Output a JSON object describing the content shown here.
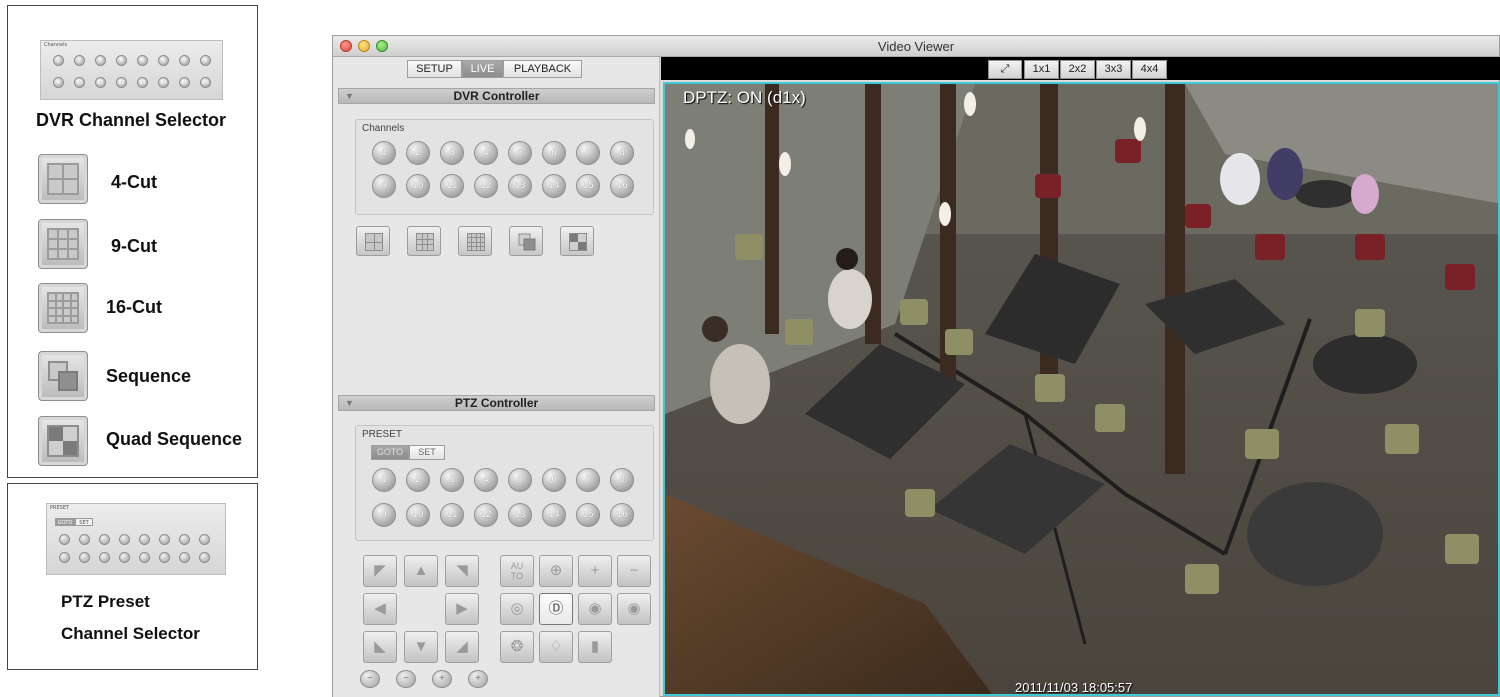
{
  "legend": {
    "channel_selector": {
      "caption": "Channels",
      "buttons": [
        "1",
        "2",
        "3",
        "4",
        "5",
        "6",
        "7",
        "8",
        "9",
        "10",
        "11",
        "12",
        "13",
        "14",
        "15",
        "16"
      ],
      "title": "DVR Channel Selector"
    },
    "items": [
      {
        "label": "4-Cut",
        "icon": "grid-2x2-icon"
      },
      {
        "label": "9-Cut",
        "icon": "grid-3x3-icon"
      },
      {
        "label": "16-Cut",
        "icon": "grid-4x4-icon"
      },
      {
        "label": "Sequence",
        "icon": "sequence-icon"
      },
      {
        "label": "Quad Sequence",
        "icon": "quad-sequence-icon"
      }
    ],
    "preset": {
      "caption": "PRESET",
      "goto_label": "GOTO",
      "set_label": "SET",
      "title_line1": "PTZ Preset",
      "title_line2": "Channel Selector"
    }
  },
  "window": {
    "title": "Video Viewer",
    "mode_tabs": [
      {
        "label": "SETUP",
        "active": false
      },
      {
        "label": "LIVE",
        "active": true
      },
      {
        "label": "PLAYBACK",
        "active": false
      }
    ],
    "dvr_controller": {
      "header": "DVR Controller",
      "channels_caption": "Channels",
      "channels": [
        "1",
        "2",
        "3",
        "4",
        "5",
        "6",
        "7",
        "8",
        "9",
        "10",
        "11",
        "12",
        "13",
        "14",
        "15",
        "16"
      ],
      "view_tools": [
        "grid-2x2-icon",
        "grid-3x3-icon",
        "grid-4x4-icon",
        "sequence-icon",
        "quad-sequence-icon"
      ]
    },
    "ptz_controller": {
      "header": "PTZ Controller",
      "preset_caption": "PRESET",
      "goto_label": "GOTO",
      "set_label": "SET",
      "presets": [
        "1",
        "2",
        "3",
        "4",
        "5",
        "6",
        "7",
        "8",
        "9",
        "10",
        "11",
        "12",
        "13",
        "14",
        "15",
        "16"
      ],
      "direction_icons": [
        "arrow-up-left-icon",
        "arrow-up-icon",
        "arrow-up-right-icon",
        "arrow-left-icon",
        "arrow-right-icon",
        "arrow-down-left-icon",
        "arrow-down-icon",
        "arrow-down-right-icon"
      ],
      "function_icons": [
        "auto-icon",
        "focus-icon",
        "zoom-in-icon",
        "zoom-out-icon",
        "iris-icon",
        "dptz-icon",
        "iris-open-icon",
        "iris-close-icon",
        "aperture-icon",
        "light-icon",
        "wiper-icon"
      ],
      "auto_label": "AUTO",
      "small_icons": [
        "minus-icon",
        "minus-icon",
        "plus-icon",
        "plus-icon"
      ]
    },
    "video_toolbar": {
      "fullscreen_icon": "fullscreen-icon",
      "layouts": [
        "1x1",
        "2x2",
        "3x3",
        "4x4"
      ]
    },
    "video": {
      "overlay": "DPTZ: ON (d1x)",
      "timestamp": "2011/11/03 18:05:57"
    }
  },
  "colors": {
    "active_border": "#3fc7d6",
    "tab_active": "#9a9a9a",
    "window_bg": "#dcdcdc"
  }
}
